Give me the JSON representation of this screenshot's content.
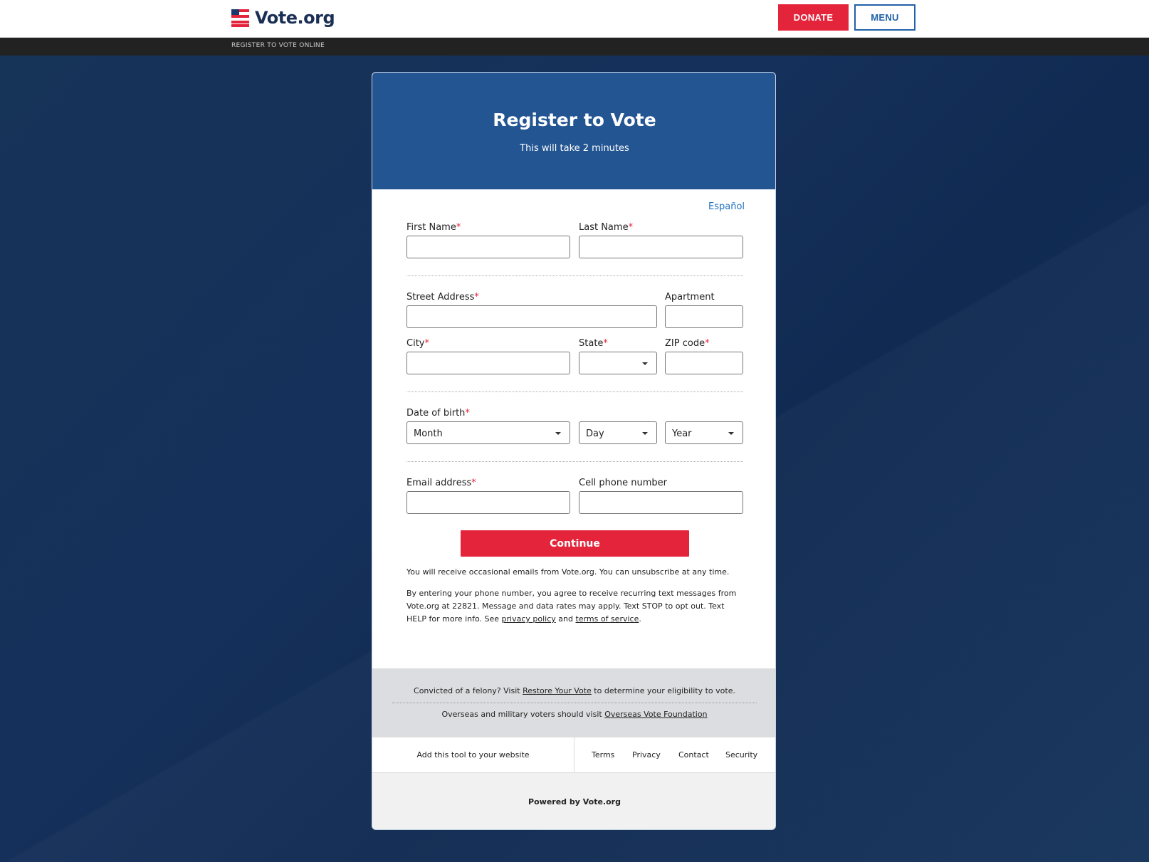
{
  "header": {
    "logo_text": "Vote.org",
    "donate_label": "DONATE",
    "menu_label": "MENU",
    "breadcrumb": "REGISTER TO VOTE ONLINE"
  },
  "card": {
    "title": "Register to Vote",
    "subtitle": "This will take 2 minutes",
    "language_link": "Español"
  },
  "form": {
    "first_name_label": "First Name",
    "last_name_label": "Last Name",
    "street_label": "Street Address",
    "apartment_label": "Apartment",
    "city_label": "City",
    "state_label": "State",
    "zip_label": "ZIP code",
    "dob_label": "Date of birth",
    "month_value": "Month",
    "day_value": "Day",
    "year_value": "Year",
    "email_label": "Email address",
    "phone_label": "Cell phone number",
    "required_mark": "*",
    "continue_label": "Continue"
  },
  "notes": {
    "email_note": "You will receive occasional emails from Vote.org. You can unsubscribe at any time.",
    "sms_note_part1": "By entering your phone number, you agree to receive recurring text messages from Vote.org at 22821. Message and data rates may apply. Text STOP to opt out. Text HELP for more info. See ",
    "privacy_link": "privacy policy",
    "and_text": " and ",
    "terms_link": "terms of service",
    "period": "."
  },
  "info_box": {
    "felony_pre": "Convicted of a felony? Visit ",
    "felony_link": "Restore Your Vote",
    "felony_post": " to determine your eligibility to vote.",
    "overseas_pre": "Overseas and military voters should visit ",
    "overseas_link": "Overseas Vote Foundation"
  },
  "footer": {
    "add_tool": "Add this tool to your website",
    "terms": "Terms",
    "privacy": "Privacy",
    "contact": "Contact",
    "security": "Security",
    "powered_by": "Powered by Vote.org"
  },
  "colors": {
    "brand_red": "#e3243b",
    "brand_blue": "#235592",
    "background_navy": "#15305a",
    "link_blue": "#2070c0"
  }
}
